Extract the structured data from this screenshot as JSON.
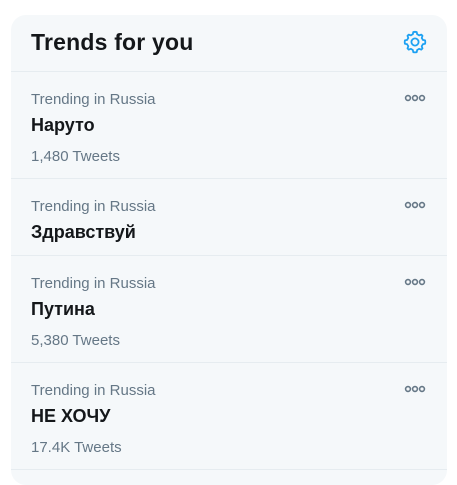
{
  "header": {
    "title": "Trends for you",
    "settings_icon": "gear-icon"
  },
  "trends": [
    {
      "context": "Trending in Russia",
      "name": "Наруто",
      "count": "1,480 Tweets",
      "more_icon": "more-icon"
    },
    {
      "context": "Trending in Russia",
      "name": "Здравствуй",
      "count": "",
      "more_icon": "more-icon"
    },
    {
      "context": "Trending in Russia",
      "name": "Путина",
      "count": "5,380 Tweets",
      "more_icon": "more-icon"
    },
    {
      "context": "Trending in Russia",
      "name": "НЕ ХОЧУ",
      "count": "17.4K Tweets",
      "more_icon": "more-icon"
    }
  ],
  "colors": {
    "accent": "#1da1f2",
    "panel_bg": "#f5f8fa",
    "divider": "#e6ecf0",
    "primary_text": "#14171a",
    "secondary_text": "#657786"
  }
}
